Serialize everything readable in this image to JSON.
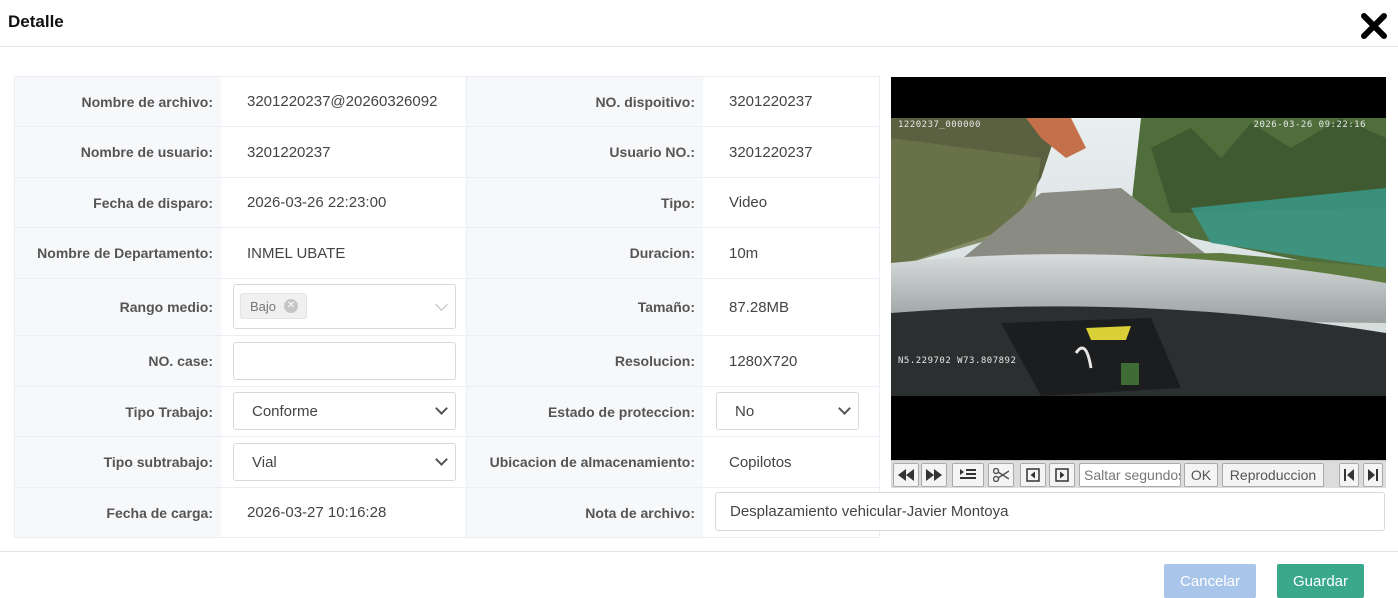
{
  "dialog": {
    "title": "Detalle"
  },
  "fields": {
    "nombre_archivo": {
      "label": "Nombre de archivo",
      "value": "3201220237@20260326092"
    },
    "no_dispositivo": {
      "label": "NO. dispoitivo",
      "value": "3201220237"
    },
    "nombre_usuario": {
      "label": "Nombre de usuario",
      "value": "3201220237"
    },
    "usuario_no": {
      "label": "Usuario NO.",
      "value": "3201220237"
    },
    "fecha_disparo": {
      "label": "Fecha de disparo",
      "value": "2026-03-26 22:23:00"
    },
    "tipo": {
      "label": "Tipo",
      "value": "Video"
    },
    "departamento": {
      "label": "Nombre de Departamento",
      "value": "INMEL UBATE"
    },
    "duracion": {
      "label": "Duracion",
      "value": "10m"
    },
    "rango_medio": {
      "label": "Rango medio",
      "tag": "Bajo"
    },
    "tamano": {
      "label": "Tamaño",
      "value": "87.28MB"
    },
    "no_case": {
      "label": "NO. case",
      "value": ""
    },
    "resolucion": {
      "label": "Resolucion",
      "value": "1280X720"
    },
    "tipo_trabajo": {
      "label": "Tipo Trabajo",
      "value": "Conforme"
    },
    "estado_proteccion": {
      "label": "Estado de proteccion",
      "value": "No"
    },
    "tipo_subtrabajo": {
      "label": "Tipo subtrabajo",
      "value": "Vial"
    },
    "ubicacion": {
      "label": "Ubicacion de almacenamiento",
      "value": "Copilotos"
    },
    "fecha_carga": {
      "label": "Fecha de carga",
      "value": "2026-03-27 10:16:28"
    },
    "nota_archivo": {
      "label": "Nota de archivo",
      "value": "Desplazamiento vehicular-Javier Montoya"
    }
  },
  "player": {
    "osd_top_left": "1220237_000000",
    "osd_top_right": "2026-03-26 09:22:16",
    "osd_bottom_left": "N5.229702 W73.807892",
    "seek_placeholder": "Saltar segundos",
    "ok_label": "OK",
    "playback_label": "Reproduccion"
  },
  "footer": {
    "cancel_label": "Cancelar",
    "save_label": "Guardar"
  },
  "colors": {
    "save": "#3aa98b",
    "cancel": "#a9c6ea",
    "label_bg": "#f7f8fa"
  }
}
